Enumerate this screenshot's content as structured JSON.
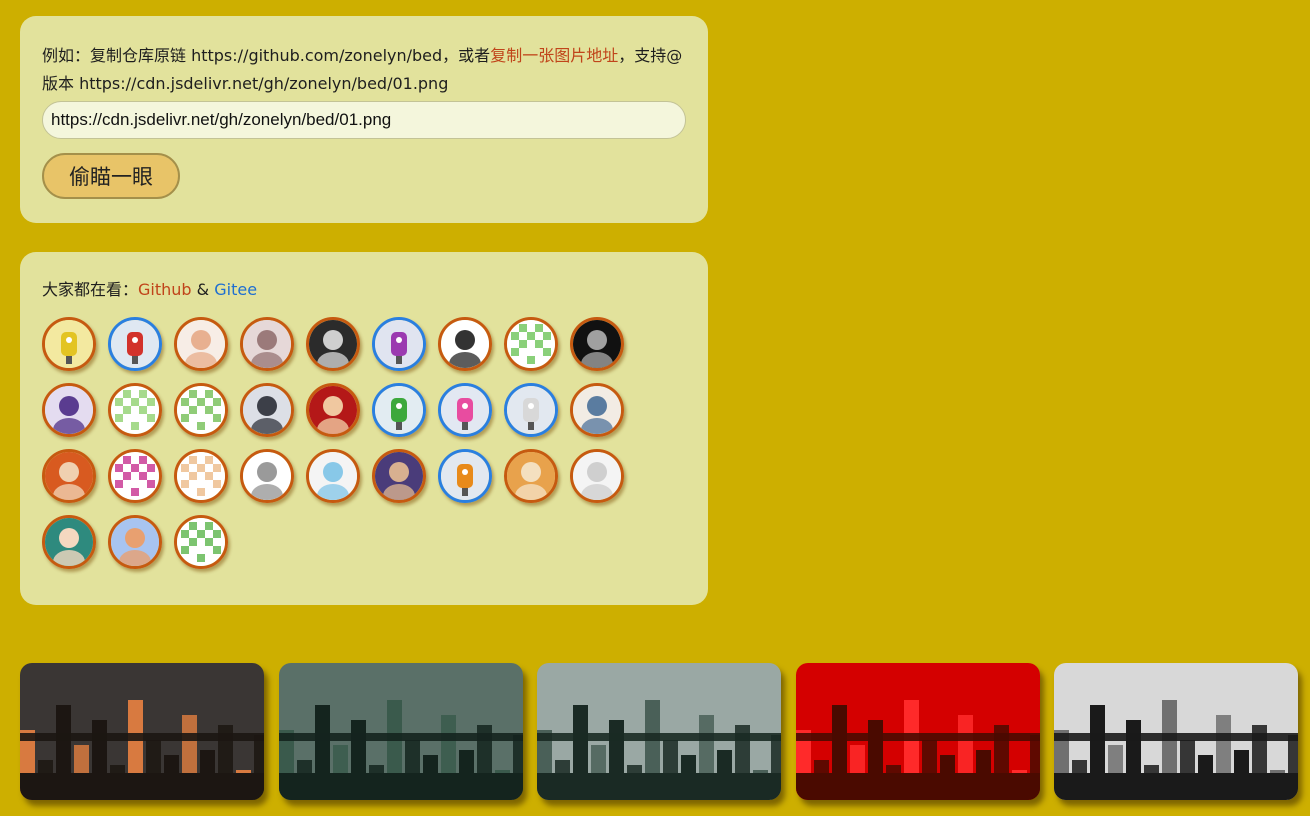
{
  "search": {
    "hint_prefix": "例如：复制仓库原链 https://github.com/zonelyn/bed，或者",
    "hint_link": "复制一张图片地址",
    "hint_suffix": "，支持@版本 https://cdn.jsdelivr.net/gh/zonelyn/bed/01.png",
    "input_value": "https://cdn.jsdelivr.net/gh/zonelyn/bed/01.png",
    "button_label": "偷瞄一眼"
  },
  "users": {
    "title_prefix": "大家都在看：",
    "github": "Github",
    "amp": " & ",
    "gitee": "Gitee",
    "avatars": [
      {
        "name": "robot-yellow-avatar",
        "ring": "orange",
        "bg": "#f3e9a0",
        "fg": "#e3c422"
      },
      {
        "name": "robot-red-avatar",
        "ring": "blue",
        "bg": "#dfe8f2",
        "fg": "#d2322b"
      },
      {
        "name": "anime-girl-sitting-avatar",
        "ring": "orange",
        "bg": "#f7ede6",
        "fg": "#e8b090"
      },
      {
        "name": "white-cat-avatar",
        "ring": "orange",
        "bg": "#e6d8d8",
        "fg": "#9b7a7a"
      },
      {
        "name": "dark-sketch-avatar",
        "ring": "orange",
        "bg": "#2b2b2b",
        "fg": "#cfcfcf"
      },
      {
        "name": "robot-purple-avatar",
        "ring": "blue",
        "bg": "#e0e4f0",
        "fg": "#9b3ab0"
      },
      {
        "name": "cartoon-face-avatar",
        "ring": "orange",
        "bg": "#ffffff",
        "fg": "#333333"
      },
      {
        "name": "identicon-green-avatar",
        "ring": "orange",
        "bg": "#ffffff",
        "fg": "#8ad07a"
      },
      {
        "name": "dinosaur-avatar",
        "ring": "orange",
        "bg": "#111111",
        "fg": "#a0a0a0"
      },
      {
        "name": "purple-hair-avatar",
        "ring": "orange",
        "bg": "#e4dcf0",
        "fg": "#5a3c90"
      },
      {
        "name": "identicon-lightgreen-avatar",
        "ring": "orange",
        "bg": "#ffffff",
        "fg": "#a6da8c"
      },
      {
        "name": "identicon-green2-avatar",
        "ring": "orange",
        "bg": "#ffffff",
        "fg": "#90cc78"
      },
      {
        "name": "anime-man-avatar",
        "ring": "orange",
        "bg": "#dcdfe6",
        "fg": "#3c3f48"
      },
      {
        "name": "red-warrior-avatar",
        "ring": "orange",
        "bg": "#b41818",
        "fg": "#f0c8a0"
      },
      {
        "name": "robot-green-avatar",
        "ring": "blue",
        "bg": "#e2ecf2",
        "fg": "#3ca83c"
      },
      {
        "name": "robot-pink-avatar",
        "ring": "blue",
        "bg": "#e2e8f2",
        "fg": "#e84ca0"
      },
      {
        "name": "robot-white-avatar",
        "ring": "blue",
        "bg": "#e2e8f0",
        "fg": "#d8d8d8"
      },
      {
        "name": "tom-cat-avatar",
        "ring": "orange",
        "bg": "#f2ece4",
        "fg": "#5a7ca0"
      },
      {
        "name": "glasses-man-avatar",
        "ring": "orange",
        "bg": "#d85a20",
        "fg": "#f0d0b0"
      },
      {
        "name": "identicon-pink-avatar",
        "ring": "orange",
        "bg": "#ffffff",
        "fg": "#d25aa6"
      },
      {
        "name": "identicon-peach-avatar",
        "ring": "orange",
        "bg": "#ffffff",
        "fg": "#f0c8a0"
      },
      {
        "name": "gray-cat-avatar",
        "ring": "orange",
        "bg": "#ffffff",
        "fg": "#9a9a9a"
      },
      {
        "name": "laughing-cartoon-avatar",
        "ring": "orange",
        "bg": "#f4f4f4",
        "fg": "#88c8e8"
      },
      {
        "name": "portrait-photo-avatar",
        "ring": "orange",
        "bg": "#4a3c7a",
        "fg": "#d8b090"
      },
      {
        "name": "robot-orange-avatar",
        "ring": "blue",
        "bg": "#e2e8f0",
        "fg": "#e88a1a"
      },
      {
        "name": "kitten-photo-avatar",
        "ring": "orange",
        "bg": "#e8a24c",
        "fg": "#f4e0c0"
      },
      {
        "name": "white-hair-avatar",
        "ring": "orange",
        "bg": "#f4f4f4",
        "fg": "#cfcfcf"
      },
      {
        "name": "anime-girl-green-avatar",
        "ring": "orange",
        "bg": "#2e8a7e",
        "fg": "#f4d8c0"
      },
      {
        "name": "cartoon-boy-avatar",
        "ring": "orange",
        "bg": "#a8c4f0",
        "fg": "#e8a070"
      },
      {
        "name": "identicon-green3-avatar",
        "ring": "orange",
        "bg": "#ffffff",
        "fg": "#7cc470"
      }
    ]
  },
  "thumbnails": [
    {
      "name": "city-night-thumb",
      "sky": "#3a3634",
      "ground": "#1c1612",
      "accent": "#d87a40"
    },
    {
      "name": "city-teal-thumb",
      "sky": "#5a7068",
      "ground": "#14241e",
      "accent": "#3a5a4c"
    },
    {
      "name": "city-grey-teal-thumb",
      "sky": "#9aa8a4",
      "ground": "#1a2a24",
      "accent": "#4a6058"
    },
    {
      "name": "city-red-thumb",
      "sky": "#d40000",
      "ground": "#4a0a00",
      "accent": "#ff2a2a"
    },
    {
      "name": "city-mono-thumb",
      "sky": "#d8d8d8",
      "ground": "#1a1a1a",
      "accent": "#707070"
    }
  ]
}
